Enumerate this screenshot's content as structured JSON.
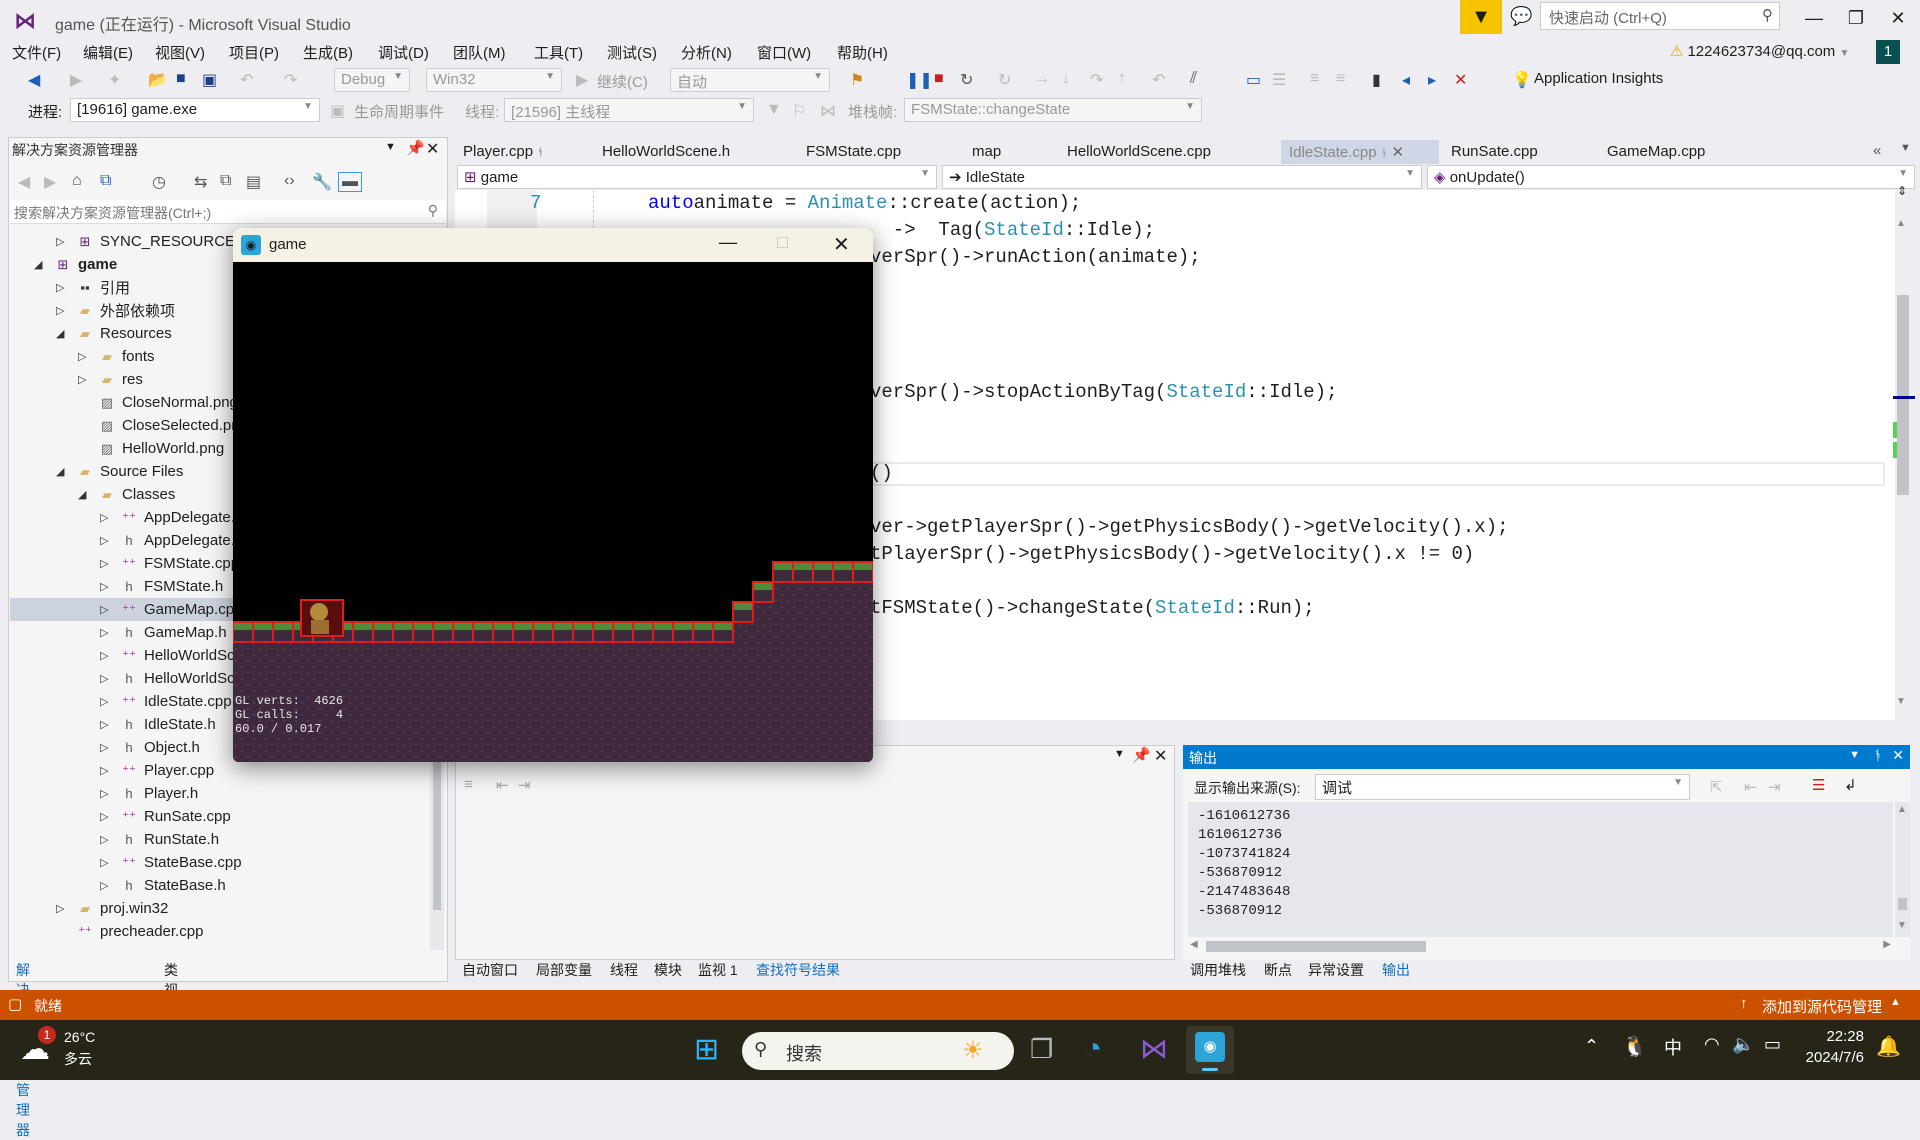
{
  "window": {
    "title": "game (正在运行) - Microsoft Visual Studio",
    "quick_launch_placeholder": "快速启动 (Ctrl+Q)"
  },
  "menu": [
    "文件(F)",
    "编辑(E)",
    "视图(V)",
    "项目(P)",
    "生成(B)",
    "调试(D)",
    "团队(M)",
    "工具(T)",
    "测试(S)",
    "分析(N)",
    "窗口(W)",
    "帮助(H)"
  ],
  "account": {
    "email": "1224623734@qq.com",
    "badge": "1"
  },
  "toolbar": {
    "config": "Debug",
    "platform": "Win32",
    "continue_label": "继续(C)",
    "auto_label": "自动",
    "app_insights": "Application Insights"
  },
  "debug_bar": {
    "process_label": "进程:",
    "process_value": "[19616] game.exe",
    "lifecycle_label": "生命周期事件",
    "thread_label": "线程:",
    "thread_value": "[21596] 主线程",
    "stackframe_label": "堆栈帧:",
    "stackframe_value": "FSMState::changeState"
  },
  "solution_explorer": {
    "title": "解决方案资源管理器",
    "search_placeholder": "搜索解决方案资源管理器(Ctrl+;)",
    "items": [
      {
        "label": "SYNC_RESOURCE-game",
        "depth": 1,
        "arrow": "right",
        "icon": "project"
      },
      {
        "label": "game",
        "depth": 0,
        "arrow": "down",
        "icon": "project",
        "bold": true
      },
      {
        "label": "引用",
        "depth": 1,
        "arrow": "right",
        "icon": "references"
      },
      {
        "label": "外部依赖项",
        "depth": 1,
        "arrow": "right",
        "icon": "folder"
      },
      {
        "label": "Resources",
        "depth": 1,
        "arrow": "down",
        "icon": "filter-folder"
      },
      {
        "label": "fonts",
        "depth": 2,
        "arrow": "right",
        "icon": "filter-folder"
      },
      {
        "label": "res",
        "depth": 2,
        "arrow": "right",
        "icon": "filter-folder"
      },
      {
        "label": "CloseNormal.png",
        "depth": 2,
        "arrow": "none",
        "icon": "image"
      },
      {
        "label": "CloseSelected.png",
        "depth": 2,
        "arrow": "none",
        "icon": "image"
      },
      {
        "label": "HelloWorld.png",
        "depth": 2,
        "arrow": "none",
        "icon": "image"
      },
      {
        "label": "Source Files",
        "depth": 1,
        "arrow": "down",
        "icon": "filter-folder"
      },
      {
        "label": "Classes",
        "depth": 2,
        "arrow": "down",
        "icon": "filter-folder"
      },
      {
        "label": "AppDelegate.cpp",
        "depth": 3,
        "arrow": "right",
        "icon": "cpp"
      },
      {
        "label": "AppDelegate.h",
        "depth": 3,
        "arrow": "right",
        "icon": "header"
      },
      {
        "label": "FSMState.cpp",
        "depth": 3,
        "arrow": "right",
        "icon": "cpp"
      },
      {
        "label": "FSMState.h",
        "depth": 3,
        "arrow": "right",
        "icon": "header"
      },
      {
        "label": "GameMap.cpp",
        "depth": 3,
        "arrow": "right",
        "icon": "cpp",
        "selected": true
      },
      {
        "label": "GameMap.h",
        "depth": 3,
        "arrow": "right",
        "icon": "header"
      },
      {
        "label": "HelloWorldScene.cpp",
        "depth": 3,
        "arrow": "right",
        "icon": "cpp"
      },
      {
        "label": "HelloWorldScene.h",
        "depth": 3,
        "arrow": "right",
        "icon": "header"
      },
      {
        "label": "IdleState.cpp",
        "depth": 3,
        "arrow": "right",
        "icon": "cpp"
      },
      {
        "label": "IdleState.h",
        "depth": 3,
        "arrow": "right",
        "icon": "header"
      },
      {
        "label": "Object.h",
        "depth": 3,
        "arrow": "right",
        "icon": "header"
      },
      {
        "label": "Player.cpp",
        "depth": 3,
        "arrow": "right",
        "icon": "cpp"
      },
      {
        "label": "Player.h",
        "depth": 3,
        "arrow": "right",
        "icon": "header"
      },
      {
        "label": "RunSate.cpp",
        "depth": 3,
        "arrow": "right",
        "icon": "cpp"
      },
      {
        "label": "RunState.h",
        "depth": 3,
        "arrow": "right",
        "icon": "header"
      },
      {
        "label": "StateBase.cpp",
        "depth": 3,
        "arrow": "right",
        "icon": "cpp"
      },
      {
        "label": "StateBase.h",
        "depth": 3,
        "arrow": "right",
        "icon": "header"
      },
      {
        "label": "proj.win32",
        "depth": 1,
        "arrow": "right",
        "icon": "filter-folder"
      },
      {
        "label": "precheader.cpp",
        "depth": 1,
        "arrow": "none",
        "icon": "cpp"
      }
    ],
    "bottom_tabs": [
      "解决方案资源管理器",
      "类视图"
    ]
  },
  "editor": {
    "tabs": [
      {
        "label": "Player.cpp",
        "pinned": true
      },
      {
        "label": "HelloWorldScene.h"
      },
      {
        "label": "FSMState.cpp"
      },
      {
        "label": "map"
      },
      {
        "label": "HelloWorldScene.cpp"
      },
      {
        "label": "IdleState.cpp",
        "active": true,
        "pinned": true
      },
      {
        "label": "RunSate.cpp"
      },
      {
        "label": "GameMap.cpp"
      }
    ],
    "nav": {
      "project": "game",
      "class": "IdleState",
      "member": "onUpdate()"
    },
    "line_number": "7",
    "lines": [
      {
        "parts": [
          [
            "kw",
            "auto"
          ],
          [
            "",
            "animate = "
          ],
          [
            "ty",
            "Animate"
          ],
          [
            "",
            "::create(action);"
          ]
        ]
      },
      {
        "parts": [
          [
            "",
            "  ->  Tag("
          ],
          [
            "ty",
            "StateId"
          ],
          [
            "",
            "::Idle);"
          ]
        ]
      },
      {
        "parts": [
          [
            "",
            "verSpr()->runAction(animate);"
          ]
        ]
      },
      {
        "parts": [
          [
            "",
            "verSpr()->stopActionByTag("
          ],
          [
            "ty",
            "StateId"
          ],
          [
            "",
            "::Idle);"
          ]
        ]
      },
      {
        "parts": [
          [
            "",
            "()"
          ]
        ]
      },
      {
        "parts": [
          [
            "",
            "ver->getPlayerSpr()->getPhysicsBody()->getVelocity().x);"
          ]
        ]
      },
      {
        "parts": [
          [
            "",
            "tPlayerSpr()->getPhysicsBody()->getVelocity().x != 0)"
          ]
        ]
      },
      {
        "parts": [
          [
            "",
            "tFSMState()->changeState("
          ],
          [
            "ty",
            "StateId"
          ],
          [
            "",
            "::Run);"
          ]
        ]
      }
    ]
  },
  "bottom_left": {
    "tabs": [
      "自动窗口",
      "局部变量",
      "线程",
      "模块",
      "监视 1",
      "查找符号结果"
    ],
    "active_tab": "查找符号结果"
  },
  "output": {
    "title": "输出",
    "source_label": "显示输出来源(S):",
    "source_value": "调试",
    "lines": [
      "-1610612736",
      "1610612736",
      "-1073741824",
      "-536870912",
      "-2147483648",
      "-536870912"
    ],
    "tabs": [
      "调用堆栈",
      "断点",
      "异常设置",
      "输出"
    ],
    "active_tab": "输出"
  },
  "game_window": {
    "title": "game",
    "hud": {
      "verts": "GL verts:  4626",
      "calls": "GL calls:     4",
      "fps": "60.0 / 0.017"
    }
  },
  "status": {
    "left": "就绪",
    "right": "添加到源代码管理"
  },
  "taskbar": {
    "weather_temp": "26°C",
    "weather_desc": "多云",
    "weather_badge": "1",
    "search": "搜索",
    "ime": "中",
    "time": "22:28",
    "date": "2024/7/6"
  },
  "colors": {
    "accent": "#007acc",
    "status": "#ca5100",
    "keyword": "#0000ff",
    "type": "#2b91af"
  }
}
